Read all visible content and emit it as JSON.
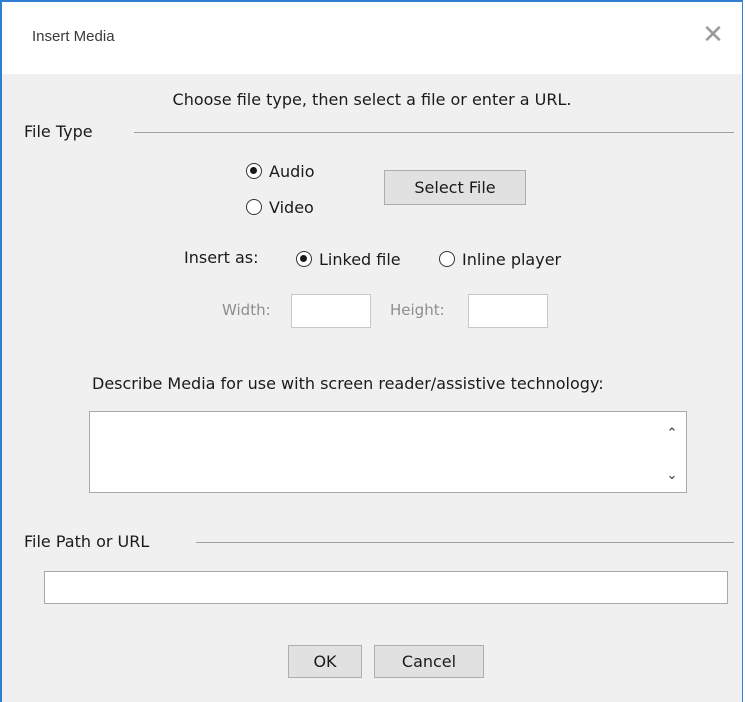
{
  "window": {
    "title": "Insert Media",
    "close_glyph": "✕"
  },
  "instruction": "Choose file type, then select a file or enter a URL.",
  "file_type": {
    "label": "File Type",
    "options": [
      {
        "label": "Audio",
        "selected": true
      },
      {
        "label": "Video",
        "selected": false
      }
    ],
    "select_button": "Select File"
  },
  "insert_as": {
    "label": "Insert as:",
    "options": [
      {
        "label": "Linked file",
        "selected": true
      },
      {
        "label": "Inline player",
        "selected": false
      }
    ]
  },
  "dimensions": {
    "width_label": "Width:",
    "width_value": "",
    "height_label": "Height:",
    "height_value": ""
  },
  "describe": {
    "label": "Describe Media for use with screen reader/assistive technology:",
    "value": ""
  },
  "file_path": {
    "label": "File Path or URL",
    "value": ""
  },
  "buttons": {
    "ok": "OK",
    "cancel": "Cancel"
  },
  "colors": {
    "accent_border": "#2f7fd4",
    "dialog_bg": "#f0f0f0",
    "button_bg": "#e1e1e1"
  }
}
